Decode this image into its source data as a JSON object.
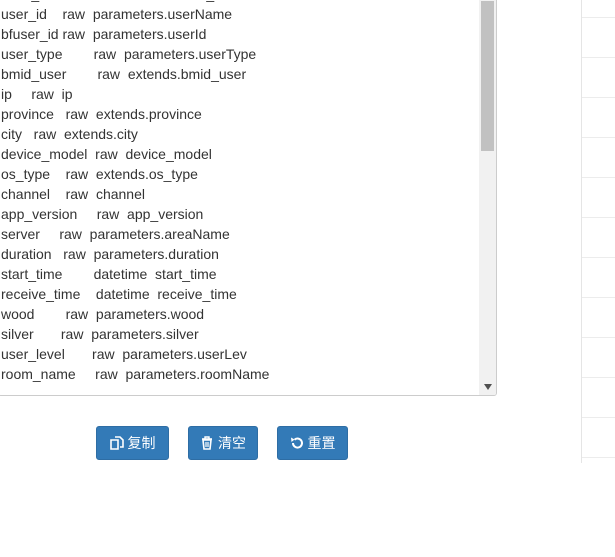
{
  "mapping_lines": [
    "bmid_dev        raw  extends.bmid_dev",
    "user_id    raw  parameters.userName",
    "bfuser_id raw  parameters.userId",
    "user_type        raw  parameters.userType",
    "bmid_user        raw  extends.bmid_user",
    "ip     raw  ip",
    "province   raw  extends.province",
    "city   raw  extends.city",
    "device_model  raw  device_model",
    "os_type    raw  extends.os_type",
    "channel    raw  channel",
    "app_version     raw  app_version",
    "server     raw  parameters.areaName",
    "duration   raw  parameters.duration",
    "start_time        datetime  start_time",
    "receive_time    datetime  receive_time",
    "wood        raw  parameters.wood",
    "silver       raw  parameters.silver",
    "user_level       raw  parameters.userLev",
    "room_name     raw  parameters.roomName"
  ],
  "buttons": {
    "copy_label": "复制",
    "clear_label": "清空",
    "reset_label": "重置"
  },
  "colors": {
    "primary": "#337ab7",
    "primary_border": "#2e6da4",
    "text": "#333333"
  },
  "icons": {
    "copy": "copy-icon",
    "clear": "trash-icon",
    "reset": "undo-icon",
    "scroll_down": "chevron-down-icon"
  }
}
